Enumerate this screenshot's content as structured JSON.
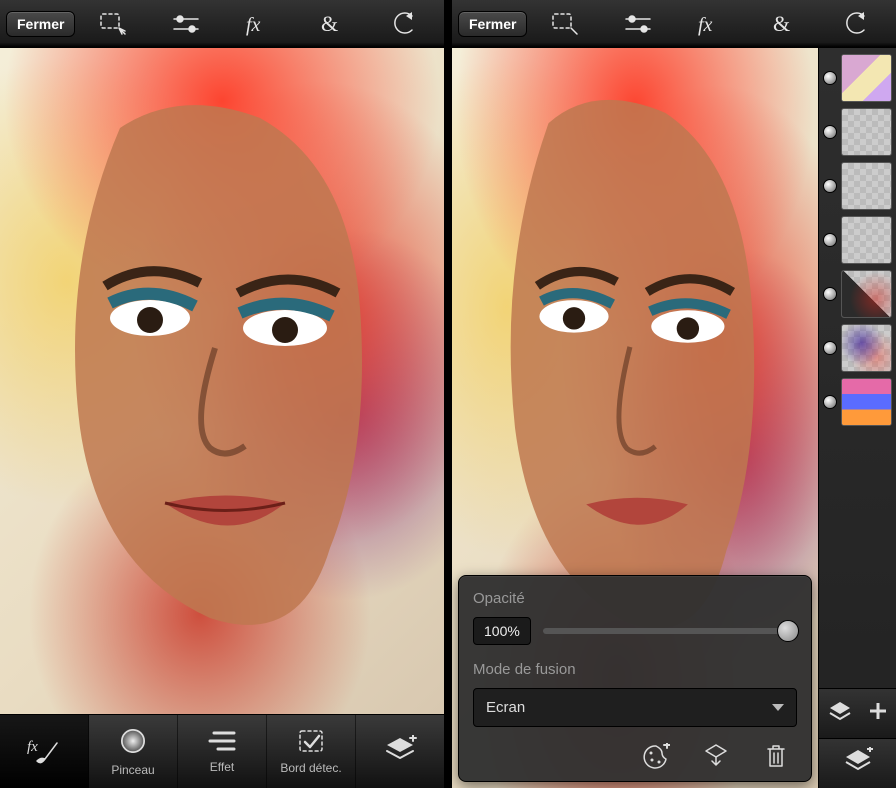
{
  "left": {
    "close_label": "Fermer",
    "toolbar": {
      "select": "select",
      "adjust": "adjust",
      "fx": "fx",
      "ampersand": "&",
      "undo": "undo"
    },
    "bottom": {
      "fx_brush": "fx-brush",
      "pinceau": "Pinceau",
      "effet": "Effet",
      "bord": "Bord détec.",
      "layers": "layers-add"
    }
  },
  "right": {
    "close_label": "Fermer",
    "panel": {
      "opacity_label": "Opacité",
      "opacity_value": "100%",
      "blend_label": "Mode de fusion",
      "blend_value": "Ecran"
    },
    "layers": [
      {
        "visible": true,
        "kind": "collage"
      },
      {
        "visible": true,
        "kind": "transparent"
      },
      {
        "visible": true,
        "kind": "transparent"
      },
      {
        "visible": true,
        "kind": "transparent"
      },
      {
        "visible": true,
        "kind": "shape-red"
      },
      {
        "visible": true,
        "kind": "ink-splash"
      },
      {
        "visible": true,
        "kind": "color-bars"
      }
    ]
  }
}
